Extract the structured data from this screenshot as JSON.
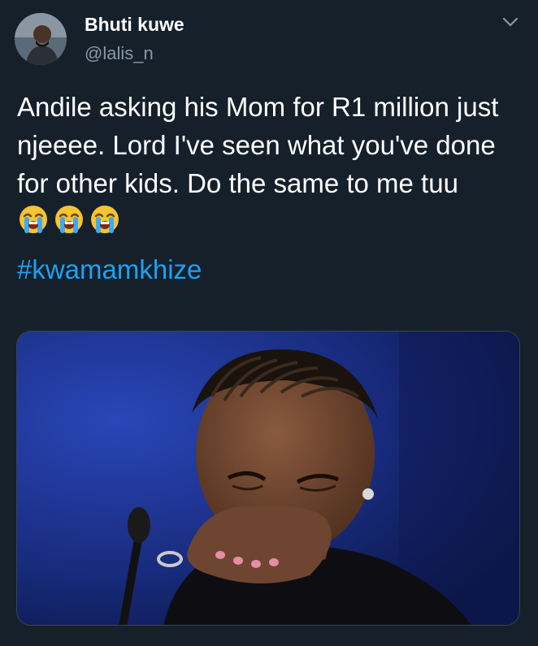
{
  "user": {
    "display_name": "Bhuti kuwe",
    "handle": "@lalis_n",
    "avatar_icon": "profile-photo"
  },
  "menu": {
    "icon": "chevron-down-icon"
  },
  "tweet": {
    "text": "Andile asking his Mom for R1 million just njeeee. Lord I've seen what you've done for other kids. Do the same to me tuu",
    "emojis": [
      "loudly-crying-face",
      "loudly-crying-face",
      "loudly-crying-face"
    ],
    "hashtag": "#kwamamkhize"
  },
  "media": {
    "description": "photo-of-crying-woman"
  },
  "colors": {
    "background": "#15202b",
    "text": "#ffffff",
    "secondary_text": "#8899a6",
    "link": "#1da1f2"
  }
}
